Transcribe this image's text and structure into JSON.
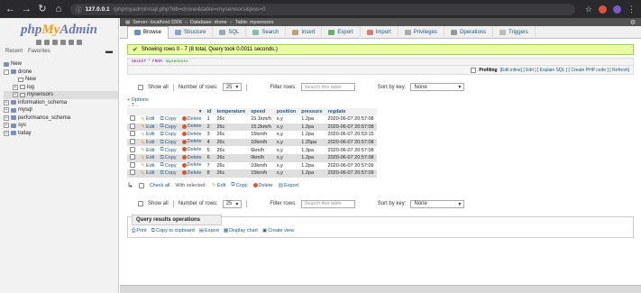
{
  "browser": {
    "url_host": "127.0.0.1",
    "url_path": "/phpmyadmin/sql.php?db=drone&table=mysensors&pos=0"
  },
  "sidebar": {
    "logo": {
      "php": "php",
      "my": "My",
      "admin": "Admin"
    },
    "recent": "Recent",
    "favorites": "Favorites",
    "tree": [
      {
        "label": "New",
        "level": 0
      },
      {
        "label": "drone",
        "level": 0
      },
      {
        "label": "New",
        "level": 1
      },
      {
        "label": "log",
        "level": 1
      },
      {
        "label": "mysensors",
        "level": 1
      },
      {
        "label": "information_schema",
        "level": 0
      },
      {
        "label": "mysql",
        "level": 0
      },
      {
        "label": "performance_schema",
        "level": 0
      },
      {
        "label": "sys",
        "level": 0
      },
      {
        "label": "today",
        "level": 0
      }
    ]
  },
  "breadcrumb": {
    "server": "Server: localhost:3306",
    "database": "Database: drone",
    "table": "Table: mysensors"
  },
  "tabs": [
    {
      "label": "Browse",
      "icon": "browse-icon",
      "color": "#6a8fc2"
    },
    {
      "label": "Structure",
      "icon": "structure-icon",
      "color": "#8aa3c8"
    },
    {
      "label": "SQL",
      "icon": "sql-icon",
      "color": "#9ab"
    },
    {
      "label": "Search",
      "icon": "search-icon",
      "color": "#8ba"
    },
    {
      "label": "Insert",
      "icon": "insert-icon",
      "color": "#bca07a"
    },
    {
      "label": "Export",
      "icon": "export-icon",
      "color": "#6ab06a"
    },
    {
      "label": "Import",
      "icon": "import-icon",
      "color": "#d08070"
    },
    {
      "label": "Privileges",
      "icon": "privileges-icon",
      "color": "#aaa"
    },
    {
      "label": "Operations",
      "icon": "operations-icon",
      "color": "#999"
    },
    {
      "label": "Triggers",
      "icon": "triggers-icon",
      "color": "#bbb"
    }
  ],
  "message": "Showing rows 0 - 7 (8 total, Query took 0.0011 seconds.)",
  "sql": {
    "kw1": "SELECT",
    "star": "*",
    "kw2": "FROM",
    "table": "`mysensors`"
  },
  "profiling": {
    "label": "Profiling",
    "links": "[Edit inline] [ Edit ] [ Explain SQL ] [ Create PHP code ] [ Refresh]"
  },
  "nav": {
    "show_all": "Show all",
    "rows_label": "Number of rows:",
    "rows_value": "25",
    "filter_label": "Filter rows:",
    "filter_placeholder": "Search this table",
    "sort_label": "Sort by key:",
    "sort_value": "None"
  },
  "options_link": "+ Options",
  "sort_arrows": "←T→",
  "columns": [
    "id",
    "temperature",
    "speed",
    "position",
    "pressure",
    "regdate"
  ],
  "row_actions": {
    "edit": "Edit",
    "copy": "Copy",
    "delete": "Delete"
  },
  "rows": [
    [
      "1",
      "26c",
      "15.1km/h",
      "x,y",
      "1.2pa",
      "2020-06-07 20:57:08"
    ],
    [
      "2",
      "26c",
      "15.2km/h",
      "x,y",
      "1.2pa",
      "2020-06-07 20:57:08"
    ],
    [
      "3",
      "26c",
      "15km/h",
      "x,y",
      "1.2pa",
      "2020-06-07 20:53:15"
    ],
    [
      "4",
      "26c",
      "10km/h",
      "x,y",
      "1.25pa",
      "2020-06-07 20:57:08"
    ],
    [
      "5",
      "26c",
      "6km/h",
      "x,y",
      "1.3pa",
      "2020-06-07 20:57:08"
    ],
    [
      "6",
      "26c",
      "0km/h",
      "x,y",
      "1.2pa",
      "2020-06-07 20:57:08"
    ],
    [
      "7",
      "26c",
      "10km/h",
      "x,y",
      "1.2pa",
      "2020-06-07 20:57:09"
    ],
    [
      "8",
      "26c",
      "15km/h",
      "x,y",
      "1.2pa",
      "2020-06-07 20:57:09"
    ]
  ],
  "bulk": {
    "check_all": "Check all",
    "with_selected": "With selected:",
    "edit": "Edit",
    "copy": "Copy",
    "delete": "Delete",
    "export": "Export"
  },
  "query_ops": {
    "title": "Query results operations",
    "print": "Print",
    "copy_clipboard": "Copy to clipboard",
    "export": "Export",
    "chart": "Display chart",
    "view": "Create view"
  }
}
